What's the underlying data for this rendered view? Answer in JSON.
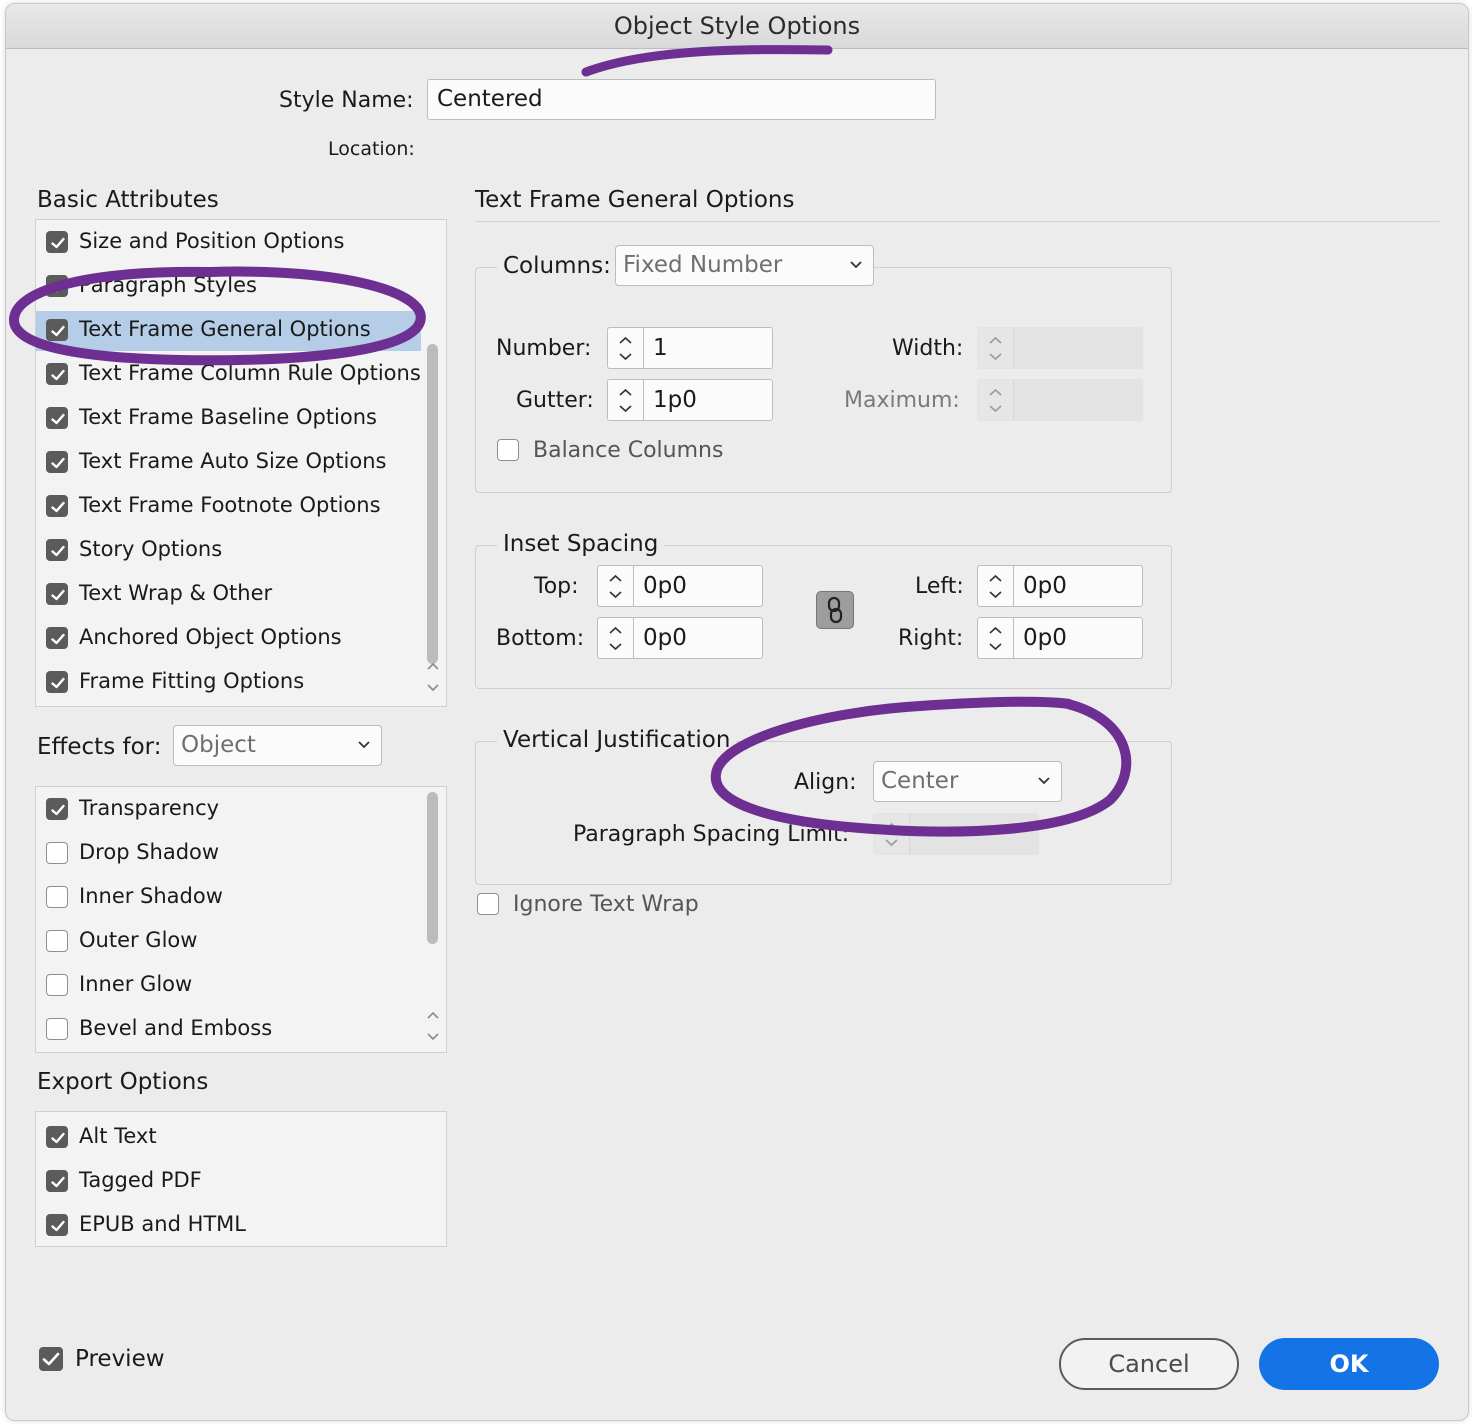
{
  "window": {
    "title": "Object Style Options"
  },
  "style_name": {
    "label": "Style Name:",
    "value": "Centered"
  },
  "location": {
    "label": "Location:"
  },
  "basic_attributes": {
    "heading": "Basic Attributes",
    "items": [
      {
        "label": "Size and Position Options",
        "checked": true
      },
      {
        "label": "Paragraph Styles",
        "checked": true
      },
      {
        "label": "Text Frame General Options",
        "checked": true,
        "selected": true
      },
      {
        "label": "Text Frame Column Rule Options",
        "checked": true
      },
      {
        "label": "Text Frame Baseline Options",
        "checked": true
      },
      {
        "label": "Text Frame Auto Size Options",
        "checked": true
      },
      {
        "label": "Text Frame Footnote Options",
        "checked": true
      },
      {
        "label": "Story Options",
        "checked": true
      },
      {
        "label": "Text Wrap & Other",
        "checked": true
      },
      {
        "label": "Anchored Object Options",
        "checked": true
      },
      {
        "label": "Frame Fitting Options",
        "checked": true
      }
    ]
  },
  "effects": {
    "label": "Effects for:",
    "selected": "Object",
    "items": [
      {
        "label": "Transparency",
        "checked": true
      },
      {
        "label": "Drop Shadow",
        "checked": false
      },
      {
        "label": "Inner Shadow",
        "checked": false
      },
      {
        "label": "Outer Glow",
        "checked": false
      },
      {
        "label": "Inner Glow",
        "checked": false
      },
      {
        "label": "Bevel and Emboss",
        "checked": false
      }
    ]
  },
  "export_options": {
    "heading": "Export Options",
    "items": [
      {
        "label": "Alt Text",
        "checked": true
      },
      {
        "label": "Tagged PDF",
        "checked": true
      },
      {
        "label": "EPUB and HTML",
        "checked": true
      }
    ]
  },
  "panel": {
    "heading": "Text Frame General Options",
    "columns": {
      "label": "Columns:",
      "selected": "Fixed Number",
      "number_label": "Number:",
      "number_value": "1",
      "gutter_label": "Gutter:",
      "gutter_value": "1p0",
      "width_label": "Width:",
      "maximum_label": "Maximum:",
      "balance_label": "Balance Columns",
      "balance_checked": false
    },
    "inset": {
      "title": "Inset Spacing",
      "top_label": "Top:",
      "top_value": "0p0",
      "bottom_label": "Bottom:",
      "bottom_value": "0p0",
      "left_label": "Left:",
      "left_value": "0p0",
      "right_label": "Right:",
      "right_value": "0p0"
    },
    "vertical": {
      "title": "Vertical Justification",
      "align_label": "Align:",
      "align_value": "Center",
      "para_spacing_label": "Paragraph Spacing Limit:"
    },
    "ignore_wrap_label": "Ignore Text Wrap",
    "ignore_wrap_checked": false
  },
  "footer": {
    "preview_label": "Preview",
    "preview_checked": true,
    "cancel_label": "Cancel",
    "ok_label": "OK"
  },
  "colors": {
    "accent": "#1473e6",
    "selection": "#b5cde6",
    "annotation": "#6e2f93"
  }
}
